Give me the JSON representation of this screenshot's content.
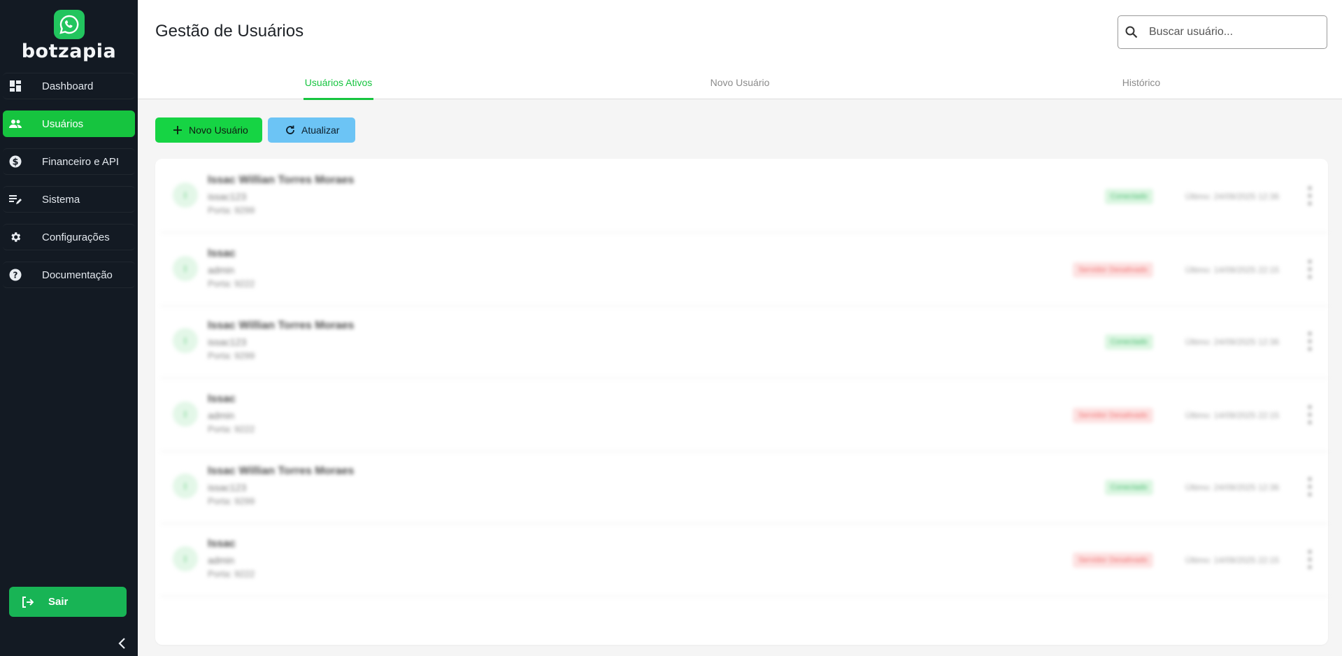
{
  "brand": {
    "name": "botzapia",
    "logo_icon": "whatsapp-phone-icon"
  },
  "sidebar": {
    "items": [
      {
        "label": "Dashboard",
        "icon": "dashboard-icon",
        "active": false
      },
      {
        "label": "Usuários",
        "icon": "users-icon",
        "active": true
      },
      {
        "label": "Financeiro e API",
        "icon": "dollar-icon",
        "active": false
      },
      {
        "label": "Sistema",
        "icon": "edit-list-icon",
        "active": false
      },
      {
        "label": "Configurações",
        "icon": "gear-icon",
        "active": false
      },
      {
        "label": "Documentação",
        "icon": "help-icon",
        "active": false
      }
    ],
    "logout_label": "Sair"
  },
  "header": {
    "title": "Gestão de Usuários",
    "search_placeholder": "Buscar usuário..."
  },
  "tabs": [
    {
      "label": "Usuários Ativos",
      "active": true
    },
    {
      "label": "Novo Usuário",
      "active": false
    },
    {
      "label": "Histórico",
      "active": false
    }
  ],
  "actions": {
    "new_user_label": "Novo Usuário",
    "refresh_label": "Atualizar"
  },
  "users": [
    {
      "avatar": "I",
      "name": "Issac Willian Torres Moraes",
      "login": "issac123",
      "port": "Porta: 9299",
      "status": "Conectado",
      "status_type": "ok",
      "last_seen": "Último: 24/09/2025 12:36"
    },
    {
      "avatar": "I",
      "name": "Issac",
      "login": "admin",
      "port": "Porta: 9222",
      "status": "Servidor Desativado",
      "status_type": "err",
      "last_seen": "Último: 14/09/2025 22:15"
    },
    {
      "avatar": "I",
      "name": "Issac Willian Torres Moraes",
      "login": "issac123",
      "port": "Porta: 9299",
      "status": "Conectado",
      "status_type": "ok",
      "last_seen": "Último: 24/09/2025 12:36"
    },
    {
      "avatar": "I",
      "name": "Issac",
      "login": "admin",
      "port": "Porta: 9222",
      "status": "Servidor Desativado",
      "status_type": "err",
      "last_seen": "Último: 14/09/2025 22:15"
    },
    {
      "avatar": "I",
      "name": "Issac Willian Torres Moraes",
      "login": "issac123",
      "port": "Porta: 9299",
      "status": "Conectado",
      "status_type": "ok",
      "last_seen": "Último: 24/09/2025 12:36"
    },
    {
      "avatar": "I",
      "name": "Issac",
      "login": "admin",
      "port": "Porta: 9222",
      "status": "Servidor Desativado",
      "status_type": "err",
      "last_seen": "Último: 14/09/2025 22:15"
    }
  ],
  "colors": {
    "accent": "#16c43f",
    "sidebar_bg": "#131a23",
    "refresh": "#6cc4f5",
    "logout": "#18b455"
  }
}
